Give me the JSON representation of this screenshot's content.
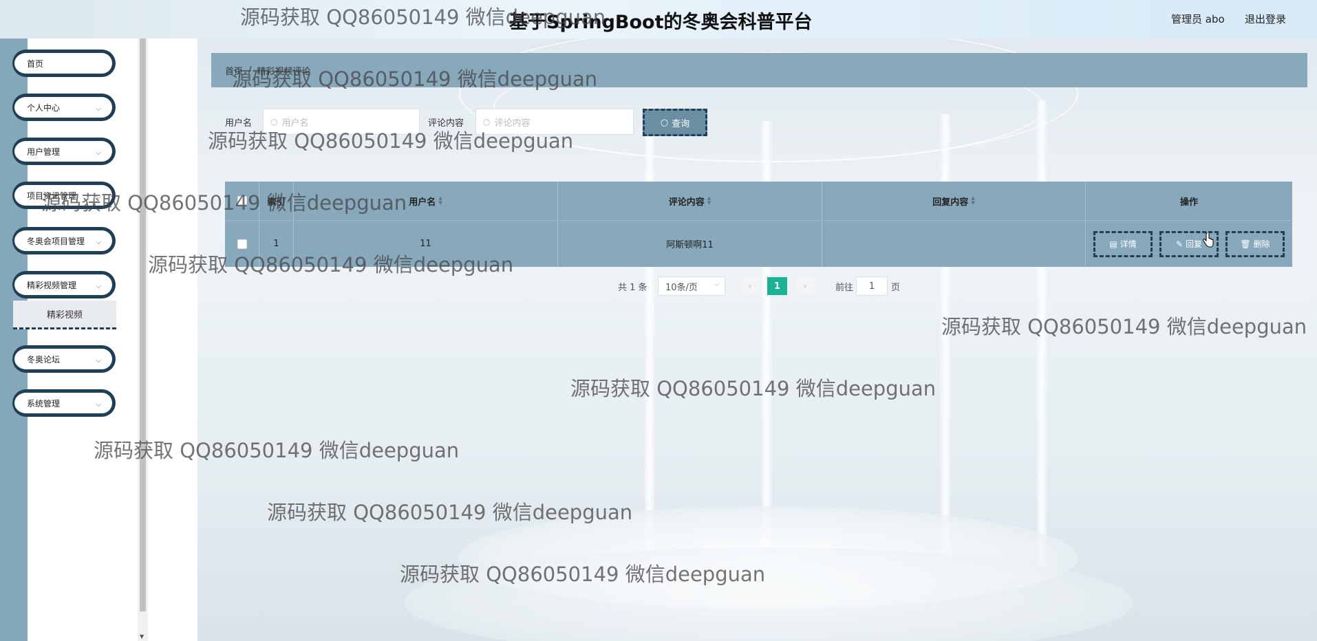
{
  "header": {
    "title": "基于SpringBoot的冬奥会科普平台",
    "user": "管理员 abo",
    "logout": "退出登录"
  },
  "sidebar": {
    "items": [
      {
        "label": "首页",
        "has_children": false
      },
      {
        "label": "个人中心",
        "has_children": true
      },
      {
        "label": "用户管理",
        "has_children": true
      },
      {
        "label": "项目资讯管理",
        "has_children": true
      },
      {
        "label": "冬奥会项目管理",
        "has_children": true
      },
      {
        "label": "精彩视频管理",
        "has_children": true,
        "expanded": true,
        "children": [
          {
            "label": "精彩视频",
            "active": true
          }
        ]
      },
      {
        "label": "冬奥论坛",
        "has_children": true
      },
      {
        "label": "系统管理",
        "has_children": true
      }
    ]
  },
  "breadcrumb": {
    "home": "首页",
    "separator": "/",
    "current": "精彩视频评论"
  },
  "search": {
    "username_label": "用户名",
    "username_placeholder": "用户名",
    "comment_label": "评论内容",
    "comment_placeholder": "评论内容",
    "query_button": "查询"
  },
  "table": {
    "columns": [
      "索引",
      "用户名",
      "评论内容",
      "回复内容",
      "操作"
    ],
    "rows": [
      {
        "index": "1",
        "username": "11",
        "comment": "阿斯顿啊11",
        "reply": ""
      }
    ],
    "actions": {
      "detail": "详情",
      "reply": "回复",
      "delete": "删除"
    }
  },
  "pagination": {
    "total": "共 1 条",
    "page_size": "10条/页",
    "current_page": "1",
    "goto_label": "前往",
    "goto_value": "1",
    "page_suffix": "页"
  },
  "watermark": "源码获取 QQ86050149 微信deepguan",
  "colors": {
    "sidebar_strip": "#84a7b9",
    "menu_border": "#1e3f55",
    "table_bg": "#87a9bb",
    "pager_active": "#1ab394"
  }
}
